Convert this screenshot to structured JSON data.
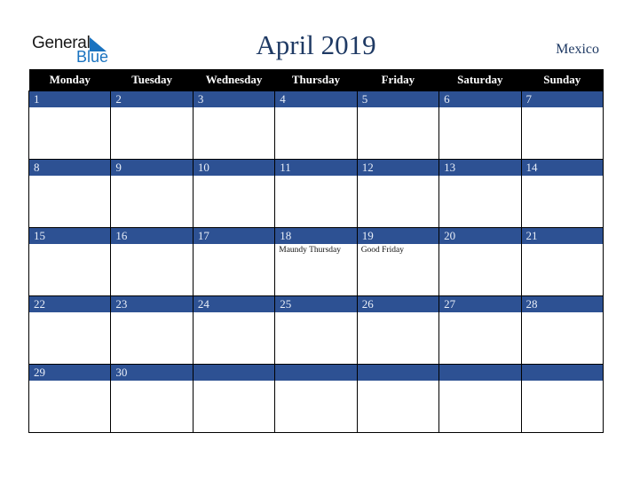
{
  "logo": {
    "line1": "General",
    "line2": "Blue",
    "icon": "triangle-flag-icon",
    "accent": "#1a73c0"
  },
  "title": "April 2019",
  "country": "Mexico",
  "colors": {
    "header_bg": "#000000",
    "band_bg": "#2d5193",
    "title": "#1f3a64"
  },
  "weekdays": [
    "Monday",
    "Tuesday",
    "Wednesday",
    "Thursday",
    "Friday",
    "Saturday",
    "Sunday"
  ],
  "weeks": [
    [
      {
        "day": "1",
        "event": ""
      },
      {
        "day": "2",
        "event": ""
      },
      {
        "day": "3",
        "event": ""
      },
      {
        "day": "4",
        "event": ""
      },
      {
        "day": "5",
        "event": ""
      },
      {
        "day": "6",
        "event": ""
      },
      {
        "day": "7",
        "event": ""
      }
    ],
    [
      {
        "day": "8",
        "event": ""
      },
      {
        "day": "9",
        "event": ""
      },
      {
        "day": "10",
        "event": ""
      },
      {
        "day": "11",
        "event": ""
      },
      {
        "day": "12",
        "event": ""
      },
      {
        "day": "13",
        "event": ""
      },
      {
        "day": "14",
        "event": ""
      }
    ],
    [
      {
        "day": "15",
        "event": ""
      },
      {
        "day": "16",
        "event": ""
      },
      {
        "day": "17",
        "event": ""
      },
      {
        "day": "18",
        "event": "Maundy Thursday"
      },
      {
        "day": "19",
        "event": "Good Friday"
      },
      {
        "day": "20",
        "event": ""
      },
      {
        "day": "21",
        "event": ""
      }
    ],
    [
      {
        "day": "22",
        "event": ""
      },
      {
        "day": "23",
        "event": ""
      },
      {
        "day": "24",
        "event": ""
      },
      {
        "day": "25",
        "event": ""
      },
      {
        "day": "26",
        "event": ""
      },
      {
        "day": "27",
        "event": ""
      },
      {
        "day": "28",
        "event": ""
      }
    ],
    [
      {
        "day": "29",
        "event": ""
      },
      {
        "day": "30",
        "event": ""
      },
      {
        "day": "",
        "event": ""
      },
      {
        "day": "",
        "event": ""
      },
      {
        "day": "",
        "event": ""
      },
      {
        "day": "",
        "event": ""
      },
      {
        "day": "",
        "event": ""
      }
    ]
  ]
}
